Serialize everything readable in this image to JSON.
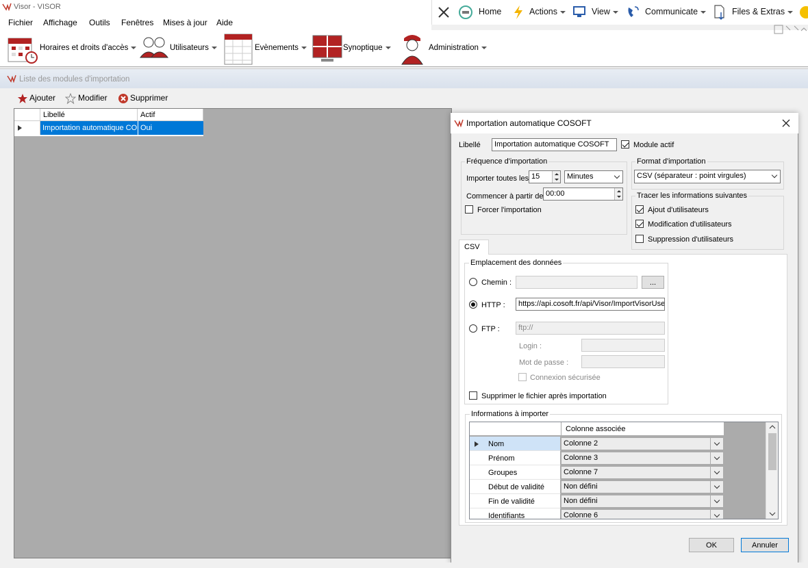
{
  "window": {
    "title": "Visor - VISOR"
  },
  "menu": [
    {
      "label": "Fichier"
    },
    {
      "label": "Affichage"
    },
    {
      "label": "Outils"
    },
    {
      "label": "Fenêtres"
    },
    {
      "label": "Mises à jour"
    },
    {
      "label": "Aide"
    }
  ],
  "remote_toolbar": {
    "home": "Home",
    "actions": "Actions",
    "view": "View",
    "communicate": "Communicate",
    "files": "Files & Extras"
  },
  "ribbon": {
    "horaires": "Horaires et droits d'accès",
    "utilisateurs": "Utilisateurs",
    "evenements": "Evènements",
    "synoptique": "Synoptique",
    "administration": "Administration"
  },
  "module_window": {
    "title": "Liste des modules d'importation",
    "toolbar": {
      "add": "Ajouter",
      "edit": "Modifier",
      "delete": "Supprimer"
    },
    "grid": {
      "columns": [
        "Libellé",
        "Actif"
      ],
      "rows": [
        {
          "libelle": "Importation automatique CO...",
          "actif": "Oui"
        }
      ]
    }
  },
  "dialog": {
    "title": "Importation automatique COSOFT",
    "libelle_label": "Libellé",
    "libelle_value": "Importation automatique COSOFT",
    "module_actif": "Module actif",
    "frequence": {
      "group": "Fréquence d'importation",
      "importer_label": "Importer toutes les",
      "importer_value": "15",
      "unit": "Minutes",
      "start_label": "Commencer à partir de",
      "start_value": "00:00",
      "force": "Forcer l'importation"
    },
    "format": {
      "group": "Format d'importation",
      "value": "CSV (séparateur : point virgules)"
    },
    "tracer": {
      "group": "Tracer les informations suivantes",
      "ajout": "Ajout d'utilisateurs",
      "modif": "Modification d'utilisateurs",
      "suppr": "Suppression d'utilisateurs"
    },
    "tab_csv": "CSV",
    "emplacement": {
      "group": "Emplacement des données",
      "chemin": "Chemin :",
      "browse": "...",
      "http": "HTTP :",
      "http_value": "https://api.cosoft.fr/api/Visor/ImportVisorUsers",
      "ftp": "FTP :",
      "ftp_placeholder": "ftp://",
      "login": "Login :",
      "password": "Mot de passe :",
      "secure": "Connexion sécurisée",
      "delete_after": "Supprimer le fichier après importation"
    },
    "infos": {
      "group": "Informations à importer",
      "column_header": "Colonne associée",
      "rows": [
        {
          "name": "Nom",
          "value": "Colonne 2"
        },
        {
          "name": "Prénom",
          "value": "Colonne 3"
        },
        {
          "name": "Groupes",
          "value": "Colonne 7"
        },
        {
          "name": "Début de validité",
          "value": "Non défini"
        },
        {
          "name": "Fin de validité",
          "value": "Non défini"
        },
        {
          "name": "Identifiants",
          "value": "Colonne 6"
        }
      ]
    },
    "ok": "OK",
    "cancel": "Annuler"
  }
}
